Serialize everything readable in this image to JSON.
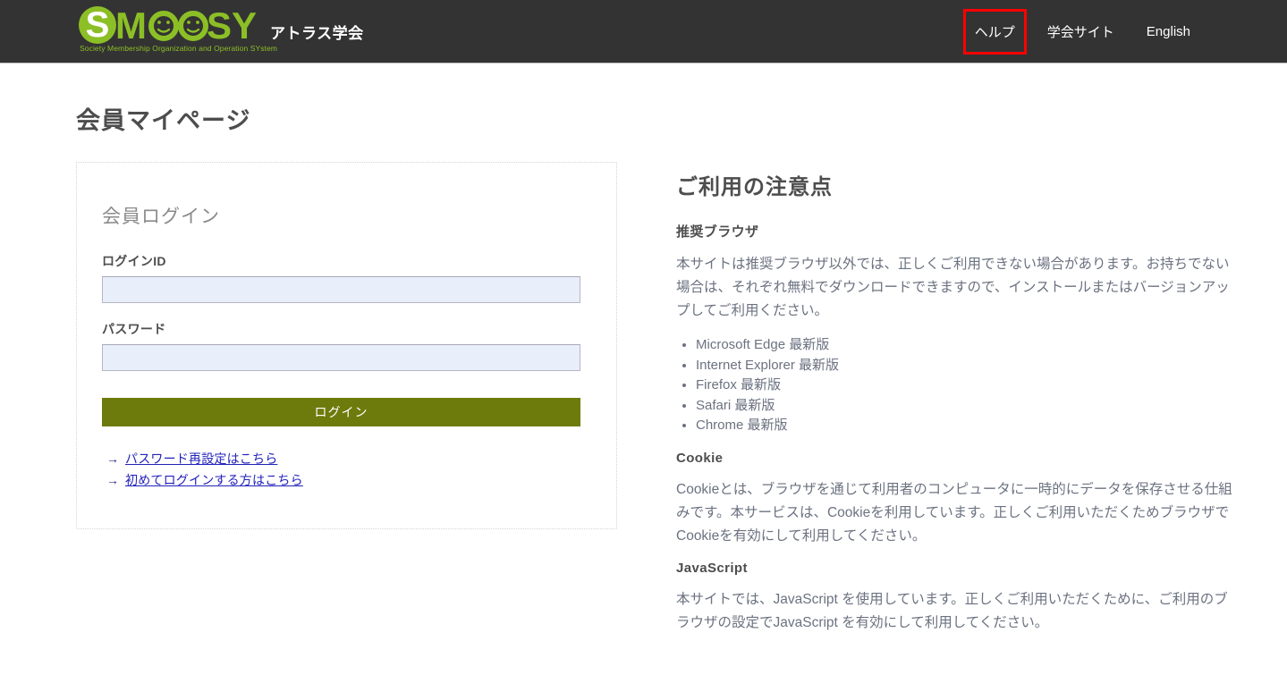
{
  "header": {
    "logo": {
      "wordmark": "SMOOSY",
      "tagline": "Society Membership Organization and Operation SYstem",
      "s_letter": "S",
      "icon_name": "smoosy-logo"
    },
    "brand_name": "アトラス学会",
    "nav": [
      {
        "label": "ヘルプ",
        "name": "nav-link-help",
        "highlighted": true
      },
      {
        "label": "学会サイト",
        "name": "nav-link-society-site",
        "highlighted": false
      },
      {
        "label": "English",
        "name": "nav-link-english",
        "highlighted": false
      }
    ],
    "highlight_color": "#ff0000",
    "background_color": "#333333"
  },
  "page": {
    "title": "会員マイページ"
  },
  "login": {
    "card_title": "会員ログイン",
    "login_id": {
      "label": "ログインID",
      "value": "",
      "placeholder": ""
    },
    "password": {
      "label": "パスワード",
      "value": "",
      "placeholder": ""
    },
    "submit_label": "ログイン",
    "submit_color": "#6d7b0c",
    "links": [
      {
        "arrow": "→",
        "label": "パスワード再設定はこちら",
        "name": "link-password-reset"
      },
      {
        "arrow": "→",
        "label": "初めてログインする方はこちら",
        "name": "link-first-time-login"
      }
    ]
  },
  "notes": {
    "title": "ご利用の注意点",
    "sections": [
      {
        "subtitle": "推奨ブラウザ",
        "paragraph": "本サイトは推奨ブラウザ以外では、正しくご利用できない場合があります。お持ちでない場合は、それぞれ無料でダウンロードできますので、インストールまたはバージョンアップしてご利用ください。",
        "list": [
          "Microsoft Edge 最新版",
          "Internet Explorer 最新版",
          "Firefox 最新版",
          "Safari 最新版",
          "Chrome 最新版"
        ]
      },
      {
        "subtitle": "Cookie",
        "paragraph": "Cookieとは、ブラウザを通じて利用者のコンピュータに一時的にデータを保存させる仕組みです。本サービスは、Cookieを利用しています。正しくご利用いただくためブラウザでCookieを有効にして利用してください。",
        "list": []
      },
      {
        "subtitle": "JavaScript",
        "paragraph": "本サイトでは、JavaScript を使用しています。正しくご利用いただくために、ご利用のブラウザの設定でJavaScript を有効にして利用してください。",
        "list": []
      }
    ]
  }
}
